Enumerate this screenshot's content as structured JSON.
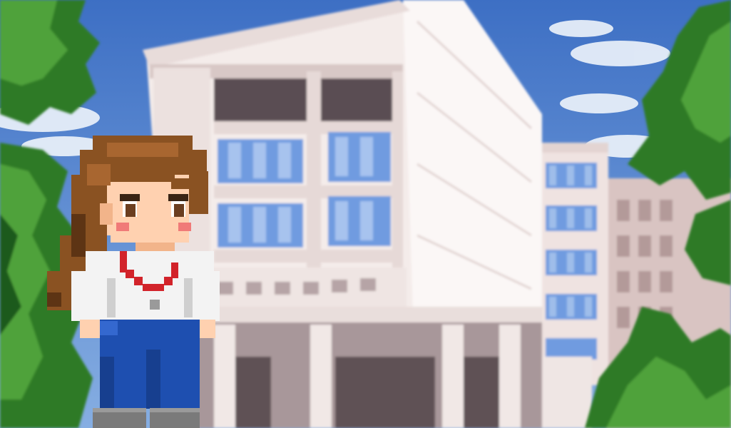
{
  "scene": {
    "setting": "campus-courtyard",
    "background_blurred": true
  },
  "palette": {
    "sky_top": "#3d6fc4",
    "sky_bottom": "#7fa8e0",
    "cloud": "#eef4fb",
    "building_light": "#f4ecea",
    "building_shadow": "#d9cbc9",
    "building_dark": "#8e7d80",
    "window_glass": "#6f9be0",
    "window_dark": "#5a4d52",
    "leaf_dark": "#1f5a1c",
    "leaf_mid": "#2e7a27",
    "leaf_light": "#4fa23a",
    "hair": "#8a5222",
    "hair_dark": "#5d3414",
    "skin": "#ffd1b0",
    "blush": "#f07a78",
    "shirt": "#f3f3f3",
    "lanyard": "#d2232a",
    "pants": "#1e4fb0",
    "shoes": "#7a7a7a"
  },
  "character": {
    "name": "",
    "role": "player-avatar"
  }
}
